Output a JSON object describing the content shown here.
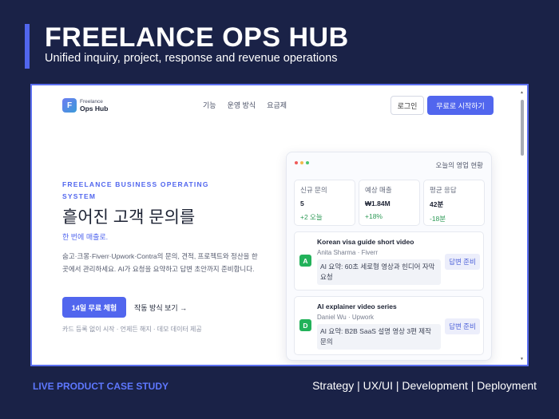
{
  "deck": {
    "title": "FREELANCE OPS HUB",
    "subtitle": "Unified inquiry, project, response and revenue operations",
    "footer_left": "LIVE PRODUCT CASE STUDY",
    "footer_right": "Strategy  |  UX/UI  |  Development  |  Deployment",
    "accent_color": "#5166ee"
  },
  "site": {
    "logo": {
      "mark": "F",
      "line1": "Freelance",
      "line2": "Ops Hub"
    },
    "nav": [
      "기능",
      "운영 방식",
      "요금제"
    ],
    "login_label": "로그인",
    "start_label": "무료로 시작하기",
    "hero": {
      "eyebrow": "FREELANCE BUSINESS OPERATING SYSTEM",
      "headline": "흩어진 고객 문의를",
      "headline_accent": "한 번에 매출로.",
      "description": "숨고·크몽·Fiverr·Upwork·Contra의 문의, 견적, 프로젝트와 정산을 한 곳에서 관리하세요. AI가 요청을 요약하고 답변 초안까지 준비합니다.",
      "trial_label": "14일 무료 체험",
      "how_label": "작동 방식 보기 →",
      "fineprint": "카드 등록 없이 시작 · 언제든 해지 · 데모 데이터 제공"
    },
    "dashboard": {
      "title": "오늘의 영업 현황",
      "stats": [
        {
          "label": "신규 문의",
          "value": "5",
          "delta": "+2 오늘"
        },
        {
          "label": "예상 매출",
          "value": "₩1.84M",
          "delta": "+18%"
        },
        {
          "label": "평균 응답",
          "value": "42분",
          "delta": "-18분"
        }
      ],
      "inquiries": [
        {
          "title": "Korean visa guide short video",
          "meta": "Anita Sharma · Fiverr",
          "avatar": "A",
          "summary": "AI 요약: 60초 세로형 영상과 힌디어 자막 요청",
          "action": "답변 준비"
        },
        {
          "title": "AI explainer video series",
          "meta": "Daniel Wu · Upwork",
          "avatar": "D",
          "summary": "AI 요약: B2B SaaS 설명 영상 3편 제작 문의",
          "action": "답변 준비"
        }
      ]
    }
  }
}
